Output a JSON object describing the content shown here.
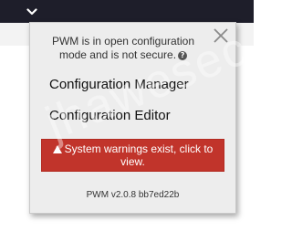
{
  "header": {
    "menu_toggle_icon": "chevron-down-icon"
  },
  "watermark": {
    "text": "jhawesec"
  },
  "dialog": {
    "message": "PWM is in open configuration mode and is not secure.",
    "help_icon": "question-circle-icon",
    "close_icon": "close-icon",
    "links": [
      {
        "label": "Configuration Manager"
      },
      {
        "label": "Configuration Editor"
      }
    ],
    "warning_button": {
      "icon": "warning-triangle-icon",
      "label": "System warnings exist, click to view."
    },
    "version": "PWM v2.0.8 bb7ed22b"
  },
  "colors": {
    "topbar": "#1e1e2a",
    "dialog_bg": "#ededed",
    "warning_button": "#c1342b"
  }
}
